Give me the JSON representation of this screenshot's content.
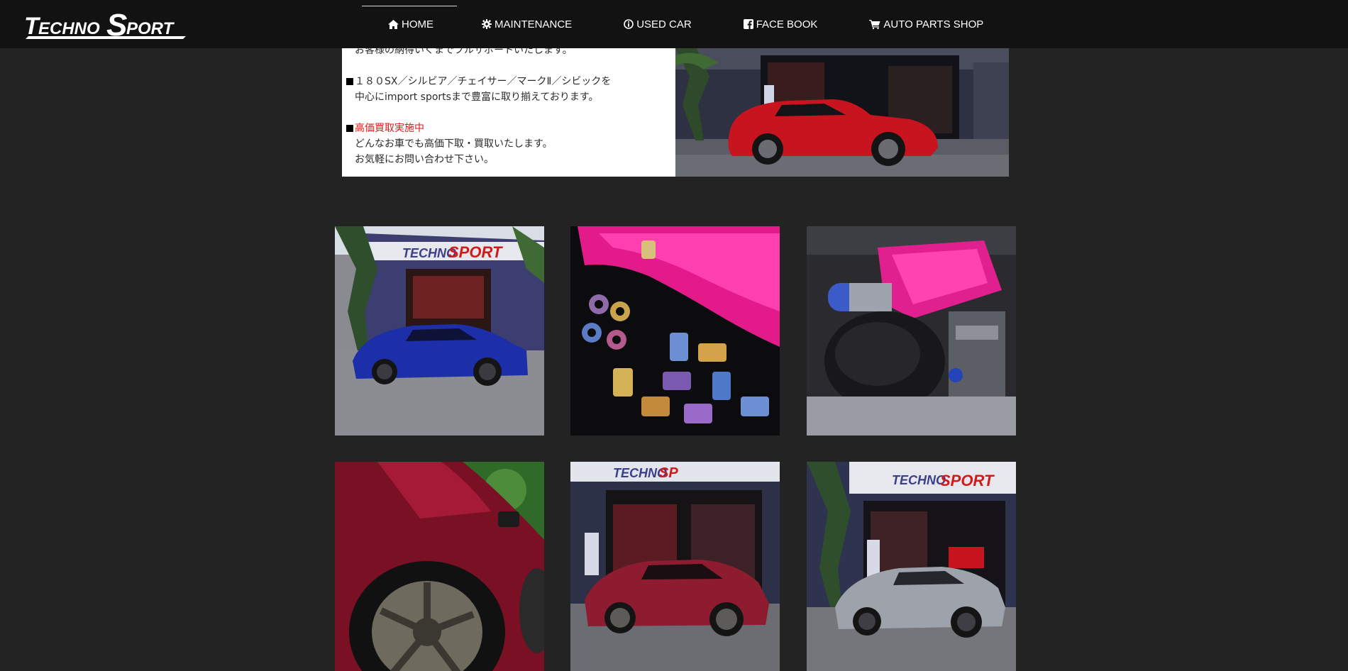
{
  "header": {
    "logo_text": "TECHNO SPORT",
    "nav": [
      {
        "label": "HOME",
        "icon": "home-icon",
        "active": true
      },
      {
        "label": "MAINTENANCE",
        "icon": "gear-icon",
        "active": false
      },
      {
        "label": "USED CAR",
        "icon": "info-icon",
        "active": false
      },
      {
        "label": "FACE BOOK",
        "icon": "facebook-icon",
        "active": false
      },
      {
        "label": "AUTO PARTS SHOP",
        "icon": "cart-icon",
        "active": false
      }
    ]
  },
  "info": {
    "line1": "お客様の納得いくまでフルサポートいたします。",
    "line2": "１８０SX／シルビア／チェイサー／マークⅡ／シビックを",
    "line3": "中心にimport sportsまで豊富に取り揃えております。",
    "line4": "高価買取実施中",
    "line5": "どんなお車でも高価下取・買取いたします。",
    "line6": "お気軽にお問い合わせ下さい。"
  },
  "gallery": [
    {
      "name": "gallery-photo-blue-chaser"
    },
    {
      "name": "gallery-photo-titanium-lug-nuts"
    },
    {
      "name": "gallery-photo-pink-engine-bay"
    },
    {
      "name": "gallery-photo-red-silvia-wheel"
    },
    {
      "name": "gallery-photo-red-silvia-garage"
    },
    {
      "name": "gallery-photo-silver-silvia-garage"
    }
  ],
  "colors": {
    "page_background": "#232323",
    "header_background": "#121212",
    "highlight_red": "#e01919"
  }
}
